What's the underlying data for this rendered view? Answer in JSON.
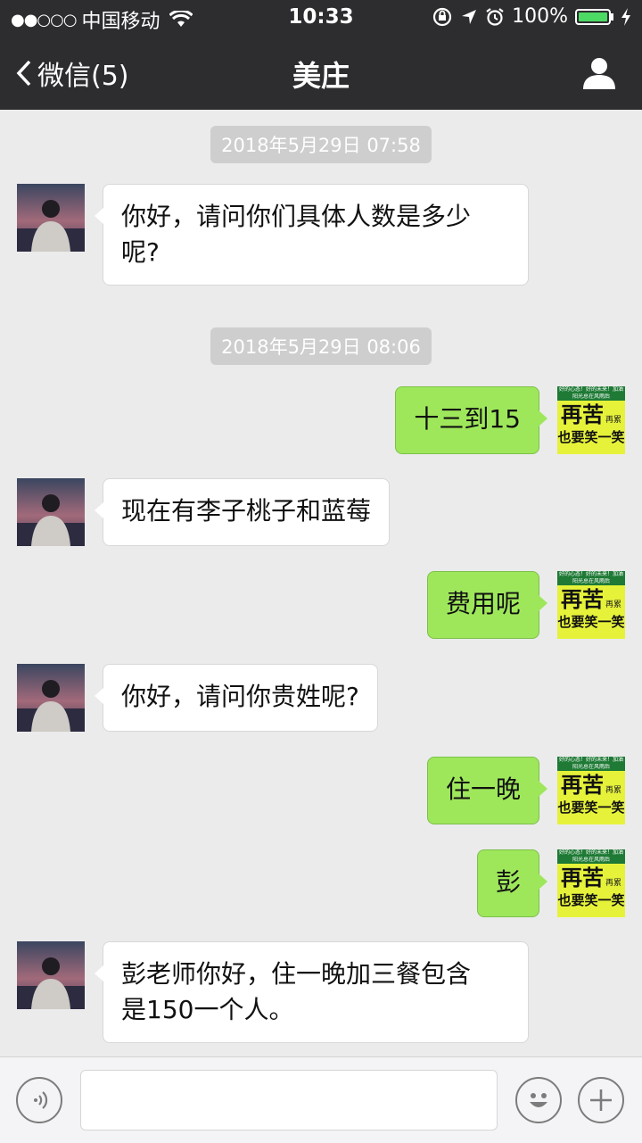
{
  "status_bar": {
    "signal": "●●○○○",
    "carrier": "中国移动",
    "time": "10:33",
    "battery": "100%",
    "battery_level": 1.0
  },
  "nav": {
    "back_label": "微信(5)",
    "title": "美庄"
  },
  "messages": [
    {
      "type": "timestamp",
      "text": "2018年5月29日 07:58"
    },
    {
      "type": "incoming",
      "lines": [
        "你好，请问你们具体人数是多少",
        "呢?"
      ]
    },
    {
      "type": "timestamp",
      "text": "2018年5月29日 08:06"
    },
    {
      "type": "outgoing",
      "text": "十三到15"
    },
    {
      "type": "incoming",
      "text": "现在有李子桃子和蓝莓"
    },
    {
      "type": "outgoing",
      "text": "费用呢"
    },
    {
      "type": "incoming",
      "text": "你好，请问你贵姓呢?"
    },
    {
      "type": "outgoing",
      "text": "住一晚"
    },
    {
      "type": "outgoing",
      "text": "彭"
    },
    {
      "type": "incoming",
      "lines": [
        "彭老师你好，住一晚加三餐包含",
        "是150一个人。"
      ]
    }
  ],
  "my_avatar": {
    "line1": "好的心态！好的未来！加油",
    "line2": "阳光总在风雨后",
    "big1": "再苦",
    "small": "再累",
    "big2": "也要笑一笑"
  },
  "colors": {
    "bar_bg": "#2d2d30",
    "outgoing_bubble": "#9ee75b",
    "incoming_bubble": "#ffffff",
    "chat_bg": "#ebebeb"
  }
}
